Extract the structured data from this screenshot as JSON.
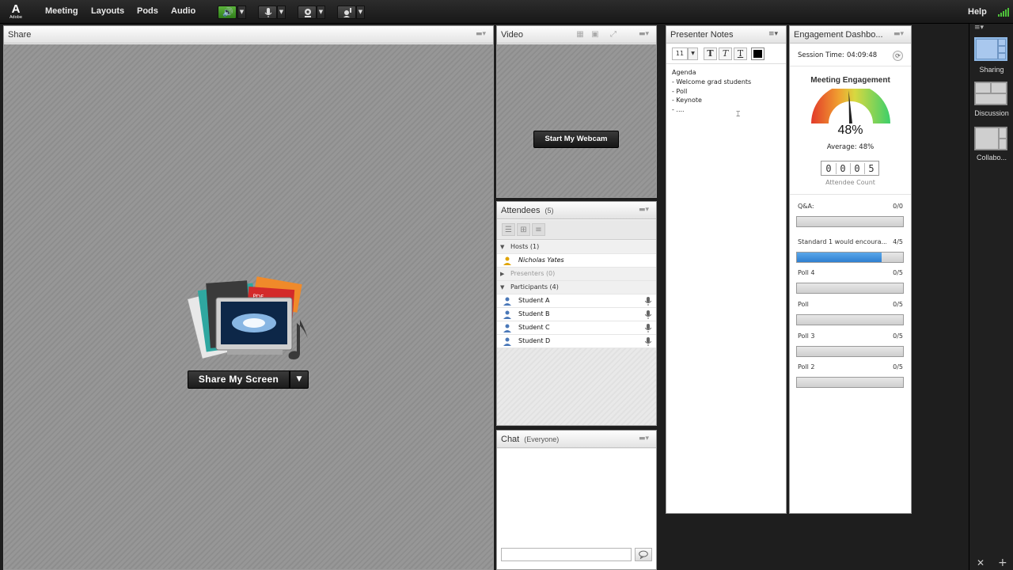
{
  "topbar": {
    "logo_word": "Adobe",
    "menus": [
      "Meeting",
      "Layouts",
      "Pods",
      "Audio"
    ],
    "help": "Help"
  },
  "share": {
    "title": "Share",
    "share_button": "Share My Screen",
    "art_labels": [
      "PPT",
      "PDF"
    ]
  },
  "video": {
    "title": "Video",
    "webcam_button": "Start My Webcam"
  },
  "attendees": {
    "title": "Attendees",
    "count": "(5)",
    "hosts_group": "Hosts (1)",
    "host_name": "Nicholas Yates",
    "presenters_group": "Presenters (0)",
    "participants_group": "Participants (4)",
    "participants": [
      "Student A",
      "Student B",
      "Student C",
      "Student D"
    ]
  },
  "chat": {
    "title": "Chat",
    "scope": "(Everyone)"
  },
  "notes": {
    "title": "Presenter Notes",
    "font_size": "11",
    "lines": [
      "Agenda",
      "- Welcome grad students",
      "- Poll",
      "- Keynote",
      "- ...."
    ]
  },
  "engagement": {
    "title": "Engagement Dashbo...",
    "session_label": "Session Time:",
    "session_time": "04:09:48",
    "meeting_title": "Meeting Engagement",
    "percent": "48%",
    "percent_value": 48,
    "average": "Average: 48%",
    "digits": [
      "0",
      "0",
      "0",
      "5"
    ],
    "count_label": "Attendee Count",
    "polls": [
      {
        "label": "Q&A:",
        "count": "0/0",
        "fraction": 0
      },
      {
        "label": "Standard 1 would encoura...",
        "count": "4/5",
        "fraction": 0.8
      },
      {
        "label": "Poll 4",
        "count": "0/5",
        "fraction": 0
      },
      {
        "label": "Poll",
        "count": "0/5",
        "fraction": 0
      },
      {
        "label": "Poll 3",
        "count": "0/5",
        "fraction": 0
      },
      {
        "label": "Poll 2",
        "count": "0/5",
        "fraction": 0
      }
    ]
  },
  "layouts": {
    "items": [
      "Sharing",
      "Discussion",
      "Collabo..."
    ],
    "active": "Sharing"
  },
  "colors": {
    "poll_fill": "#3b8ee0",
    "audio_on": "#4aa52c"
  }
}
